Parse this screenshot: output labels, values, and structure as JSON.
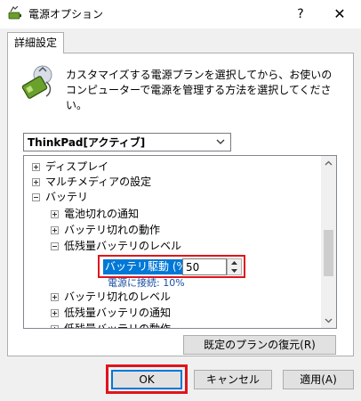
{
  "window": {
    "title": "電源オプション",
    "help_glyph": "?",
    "close_glyph": "✕"
  },
  "tab": {
    "label": "詳細設定"
  },
  "description": "カスタマイズする電源プランを選択してから、お使いのコンピューターで電源を管理する方法を選択してください。",
  "plan_select": {
    "value": "ThinkPad[アクティブ]"
  },
  "tree": {
    "items": [
      {
        "label": "ディスプレイ",
        "expander": "plus"
      },
      {
        "label": "マルチメディアの設定",
        "expander": "plus"
      },
      {
        "label": "バッテリ",
        "expander": "minus"
      },
      {
        "label": "電池切れの通知",
        "expander": "plus"
      },
      {
        "label": "バッテリ切れの動作",
        "expander": "plus"
      },
      {
        "label": "低残量バッテリのレベル",
        "expander": "minus"
      },
      {
        "label": "バッテリ切れのレベル",
        "expander": "plus"
      },
      {
        "label": "低残量バッテリの通知",
        "expander": "plus"
      },
      {
        "label": "低残量バッテリの動作",
        "expander": "plus"
      }
    ],
    "setting": {
      "battery_label": "バッテリ駆動 (%):",
      "battery_value": "50",
      "ac_label": "電源に接続:",
      "ac_value": "10%"
    },
    "scroll_position_fraction": 0.62
  },
  "buttons": {
    "restore": "既定のプランの復元(R)",
    "ok": "OK",
    "cancel": "キャンセル",
    "apply": "適用(A)"
  },
  "colors": {
    "accent": "#0078d7",
    "highlight_outline": "#e0141c",
    "ac_value_text": "#1a4fa0"
  },
  "icons": {
    "app": "power-options-battery-icon",
    "header": "battery-plug-icon"
  }
}
